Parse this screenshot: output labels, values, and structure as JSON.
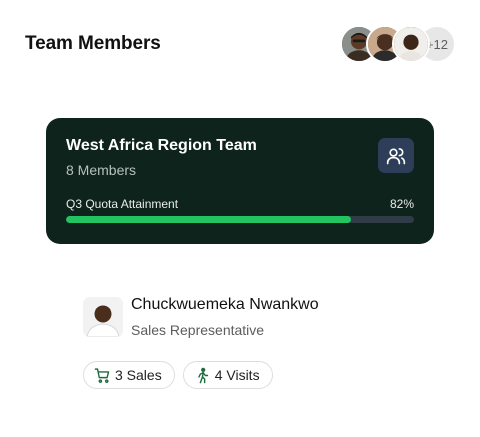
{
  "header": {
    "title": "Team Members",
    "avatars": [
      "member-avatar-1",
      "member-avatar-2",
      "member-avatar-3"
    ],
    "more_count": "+12"
  },
  "team": {
    "name": "West Africa Region Team",
    "member_count": "8 Members",
    "icon": "users-icon",
    "quota_label": "Q3 Quota Attainment",
    "quota_value": "82%",
    "quota_fraction": 0.82,
    "colors": {
      "card_bg": "#0f231d",
      "bar_fill": "#22c461",
      "bar_track": "#2f3b45",
      "icon_bg": "#2e3d58"
    }
  },
  "member": {
    "name": "Chuckwuemeka Nwankwo",
    "role": "Sales Representative",
    "stats": [
      {
        "icon": "shopping-cart-icon",
        "label": "3 Sales"
      },
      {
        "icon": "walking-person-icon",
        "label": "4 Visits"
      }
    ]
  }
}
